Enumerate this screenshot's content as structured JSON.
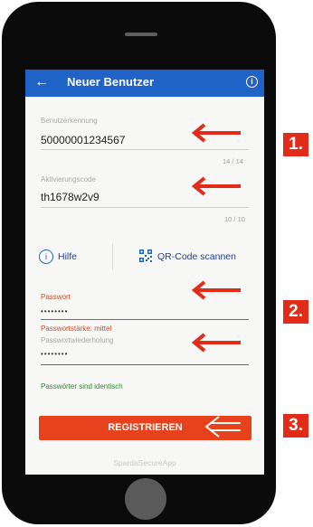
{
  "app": {
    "title": "Neuer Benutzer"
  },
  "fields": {
    "user_id": {
      "label": "Benutzerkennung",
      "value": "50000001234567",
      "counter": "14 / 14"
    },
    "activation": {
      "label": "Aktivierungscode",
      "value": "th1678w2v9",
      "counter": "10 / 10"
    },
    "password": {
      "label": "Passwort",
      "value": "••••••••",
      "strength": "Passwortstärke: mittel"
    },
    "password_repeat": {
      "label": "Passwortwiederholung",
      "value": "••••••••",
      "match": "Passwörter sind identisch"
    }
  },
  "actions": {
    "help": "Hilfe",
    "scan": "QR-Code scannen",
    "register": "REGISTRIEREN"
  },
  "footer": "SpardaSecureApp",
  "steps": [
    "1.",
    "2.",
    "3."
  ],
  "colors": {
    "accent_blue": "#1f63c6",
    "error_orange": "#e8421c",
    "success_green": "#2e8b2e",
    "annotation_red": "#e22b18"
  }
}
